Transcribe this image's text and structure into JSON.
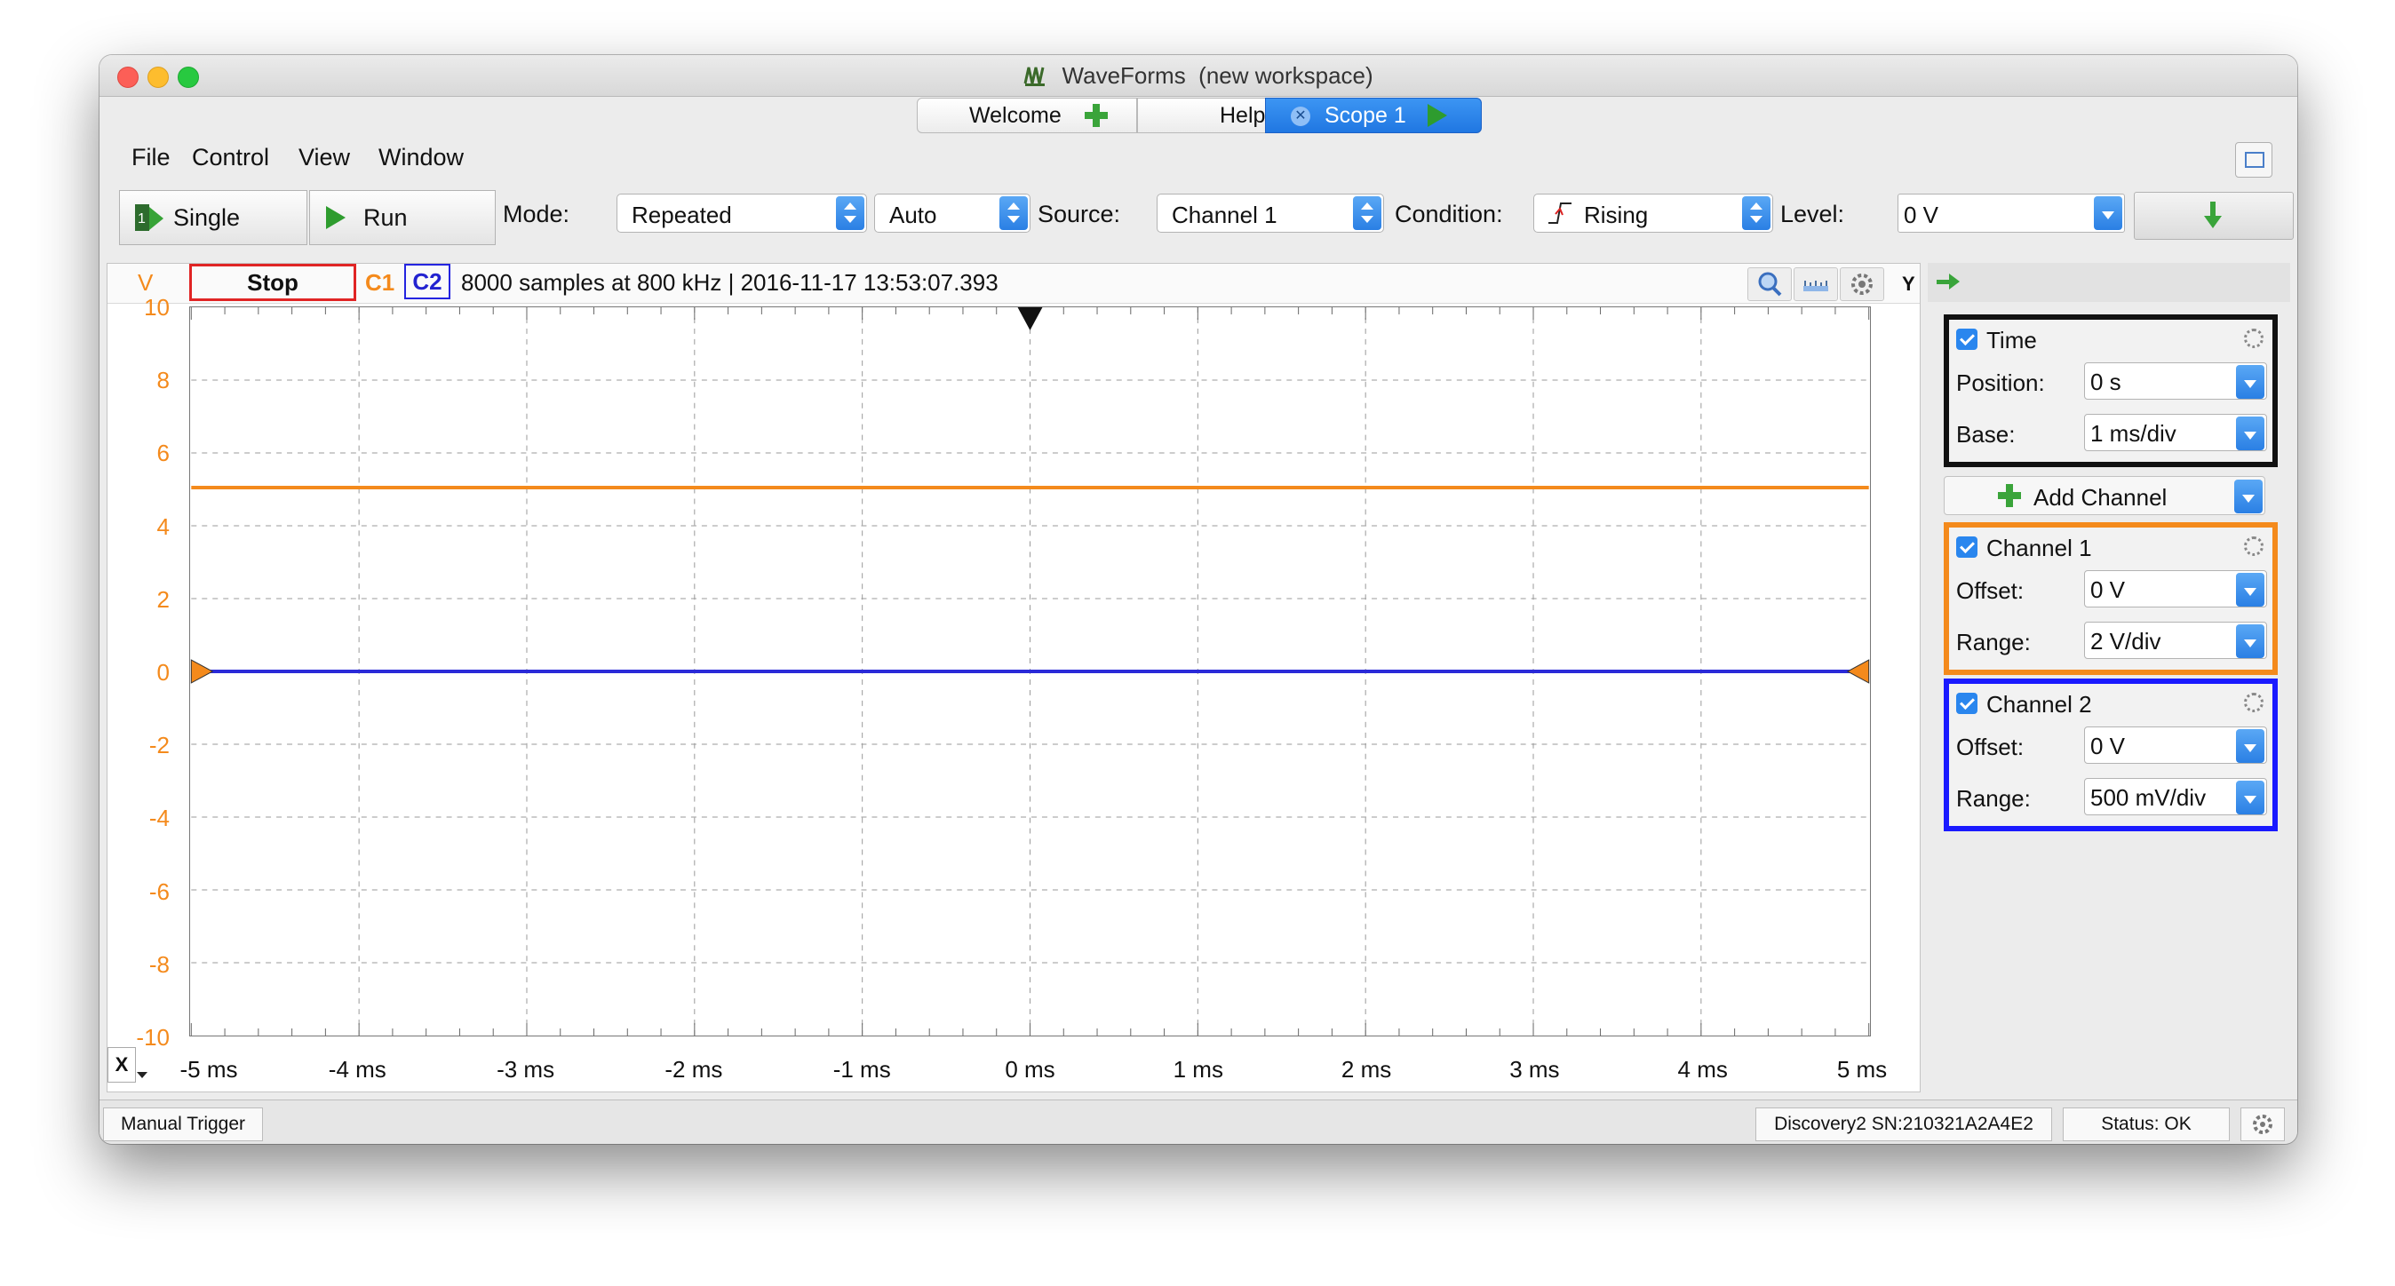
{
  "window": {
    "title": "WaveForms",
    "subtitle": "(new workspace)"
  },
  "tabs": {
    "welcome": "Welcome",
    "help": "Help",
    "scope": "Scope 1"
  },
  "menu": [
    "File",
    "Control",
    "View",
    "Window"
  ],
  "toolbar": {
    "single_label": "Single",
    "run_label": "Run",
    "mode_label": "Mode:",
    "mode_value": "Repeated",
    "mode2_value": "Auto",
    "source_label": "Source:",
    "source_value": "Channel 1",
    "condition_label": "Condition:",
    "condition_value": "Rising",
    "level_label": "Level:",
    "level_value": "0 V"
  },
  "plot_header": {
    "v_unit": "V",
    "stop_label": "Stop",
    "c1": "C1",
    "c2": "C2",
    "sample_info": "8000 samples at 800 kHz | 2016-11-17 13:53:07.393",
    "y_label": "Y"
  },
  "colors": {
    "ch1": "#f48a1c",
    "ch2": "#2a2ad8",
    "accent": "#2a86ee"
  },
  "chart_data": {
    "type": "line",
    "y_ticks": [
      "10",
      "8",
      "6",
      "4",
      "2",
      "0",
      "-2",
      "-4",
      "-6",
      "-8",
      "-10"
    ],
    "x_ticks": [
      "-5 ms",
      "-4 ms",
      "-3 ms",
      "-2 ms",
      "-1 ms",
      "0 ms",
      "1 ms",
      "2 ms",
      "3 ms",
      "4 ms",
      "5 ms"
    ],
    "xlim": [
      -5,
      5
    ],
    "ylim": [
      -10,
      10
    ],
    "grid": true,
    "series": [
      {
        "name": "C1",
        "color": "#f48a1c",
        "x": [
          -5,
          5
        ],
        "y": [
          5.05,
          5.05
        ]
      },
      {
        "name": "C2",
        "color": "#2a2ad8",
        "x": [
          -5,
          5
        ],
        "y": [
          0.0,
          0.0
        ]
      }
    ]
  },
  "x_button": "X",
  "right_panel": {
    "time": {
      "title": "Time",
      "position_label": "Position:",
      "position_value": "0 s",
      "base_label": "Base:",
      "base_value": "1 ms/div"
    },
    "add_channel": "Add Channel",
    "channel1": {
      "title": "Channel 1",
      "offset_label": "Offset:",
      "offset_value": "0 V",
      "range_label": "Range:",
      "range_value": "2 V/div"
    },
    "channel2": {
      "title": "Channel 2",
      "offset_label": "Offset:",
      "offset_value": "0 V",
      "range_label": "Range:",
      "range_value": "500 mV/div"
    }
  },
  "status": {
    "manual_trigger": "Manual Trigger",
    "device": "Discovery2 SN:210321A2A4E2",
    "status": "Status: OK"
  }
}
